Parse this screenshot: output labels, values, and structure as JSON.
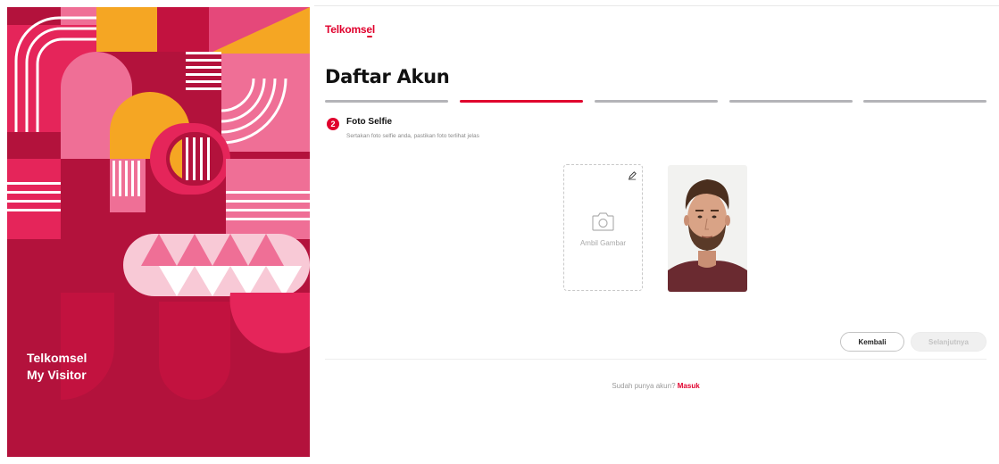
{
  "brand": {
    "logo_text": "Telkomsel",
    "panel_title_line1": "Telkomsel",
    "panel_title_line2": "My Visitor"
  },
  "page": {
    "title": "Daftar Akun"
  },
  "stepper": {
    "total_steps": 5,
    "active_step": 2
  },
  "step": {
    "number": "2",
    "title": "Foto Selfie",
    "description": "Sertakan foto selfie anda, pastikan foto terlihat jelas"
  },
  "upload": {
    "label": "Ambil Gambar"
  },
  "actions": {
    "back_label": "Kembali",
    "next_label": "Selanjutnya"
  },
  "footer": {
    "prompt": "Sudah punya akun?",
    "link": "Masuk"
  },
  "colors": {
    "primary": "#e0002d",
    "panel_bg": "#b3123c"
  }
}
